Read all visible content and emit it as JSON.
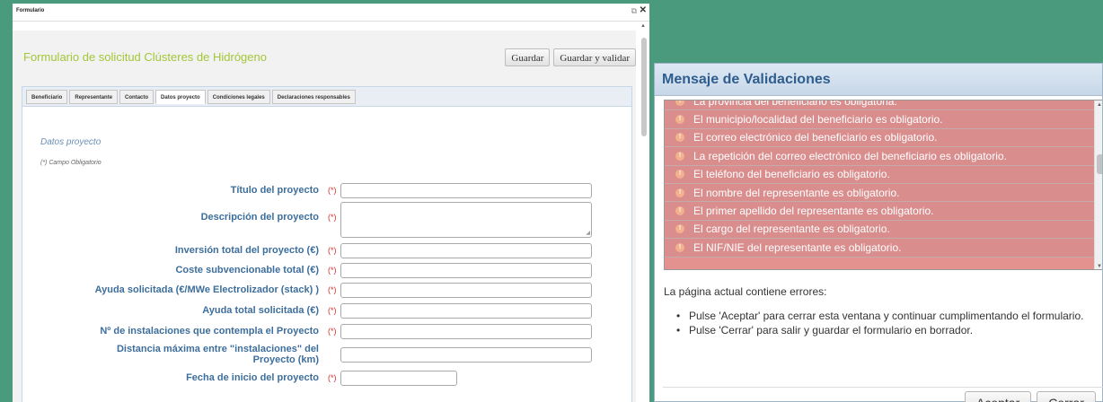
{
  "window": {
    "title": "Formulario",
    "popout_icon": "popout-icon",
    "close_icon": "close-icon"
  },
  "form": {
    "title": "Formulario de solicitud Clústeres de Hidrógeno",
    "buttons": {
      "save_label": "Guardar",
      "save_validate_label": "Guardar y validar"
    },
    "tabs": [
      {
        "label": "Beneficiario",
        "active": false
      },
      {
        "label": "Representante",
        "active": false
      },
      {
        "label": "Contacto",
        "active": false
      },
      {
        "label": "Datos proyecto",
        "active": true
      },
      {
        "label": "Condiciones legales",
        "active": false
      },
      {
        "label": "Declaraciones responsables",
        "active": false
      }
    ],
    "section_title": "Datos proyecto",
    "required_note": "(*) Campo Obligatorio",
    "required_marker": "(*)",
    "fields": [
      {
        "label": "Título del proyecto",
        "value": ""
      },
      {
        "label": "Descripción del proyecto",
        "value": ""
      },
      {
        "label": "Inversión total del proyecto (€)",
        "value": ""
      },
      {
        "label": "Coste subvencionable total (€)",
        "value": ""
      },
      {
        "label": "Ayuda solicitada (€/MWe Electrolizador (stack) )",
        "value": ""
      },
      {
        "label": "Ayuda total solicitada (€)",
        "value": ""
      },
      {
        "label": "Nº de instalaciones que contempla el Proyecto",
        "value": ""
      },
      {
        "label": "Distancia máxima entre \"instalaciones\" del Proyecto (km)",
        "value": ""
      },
      {
        "label": "Fecha de inicio del proyecto",
        "value": ""
      }
    ]
  },
  "dialog": {
    "title": "Mensaje de Validaciones",
    "errors": [
      "La provincia del beneficiario es obligatoria.",
      "El municipio/localidad del beneficiario es obligatorio.",
      "El correo electrónico del beneficiario es obligatorio.",
      "La repetición del correo electrónico del beneficiario es obligatorio.",
      "El teléfono del beneficiario es obligatorio.",
      "El nombre del representante es obligatorio.",
      "El primer apellido del representante es obligatorio.",
      "El cargo del representante es obligatorio.",
      "El NIF/NIE del representante es obligatorio."
    ],
    "message": "La página actual contiene errores:",
    "bullets": [
      "Pulse 'Aceptar' para cerrar esta ventana y continuar cumplimentando el formulario.",
      "Pulse 'Cerrar' para salir y guardar el formulario en borrador."
    ],
    "accept_label": "Aceptar",
    "close_label": "Cerrar"
  }
}
